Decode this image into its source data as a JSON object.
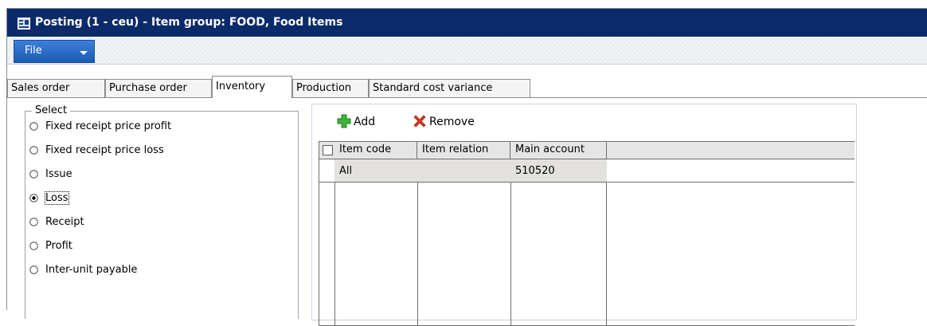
{
  "window": {
    "title": "Posting (1 - ceu) - Item group: FOOD, Food Items",
    "icon": "posting-form-icon"
  },
  "menu": {
    "file_label": "File",
    "file_icon": "chevron-down-icon"
  },
  "tabs": [
    {
      "label": "Sales order",
      "active": false
    },
    {
      "label": "Purchase order",
      "active": false
    },
    {
      "label": "Inventory",
      "active": true
    },
    {
      "label": "Production",
      "active": false
    },
    {
      "label": "Standard cost variance",
      "active": false
    }
  ],
  "select_group": {
    "legend": "Select",
    "options": [
      {
        "label": "Fixed receipt price profit",
        "selected": false
      },
      {
        "label": "Fixed receipt price loss",
        "selected": false
      },
      {
        "label": "Issue",
        "selected": false
      },
      {
        "label": "Loss",
        "selected": true
      },
      {
        "label": "Receipt",
        "selected": false
      },
      {
        "label": "Profit",
        "selected": false
      },
      {
        "label": "Inter-unit payable",
        "selected": false
      }
    ]
  },
  "toolbar": {
    "add_label": "Add",
    "add_icon": "plus-icon",
    "remove_label": "Remove",
    "remove_icon": "x-icon"
  },
  "grid": {
    "columns": [
      "Item code",
      "Item relation",
      "Main account"
    ],
    "rows": [
      {
        "item_code": "All",
        "item_relation": "",
        "main_account": "510520"
      }
    ]
  },
  "colors": {
    "title_bar": "#0b2a6a",
    "file_button": "#2a6bc8",
    "add_icon": "#3cb33c",
    "remove_icon": "#e23a1c",
    "selected_row": "#e3e1de"
  }
}
